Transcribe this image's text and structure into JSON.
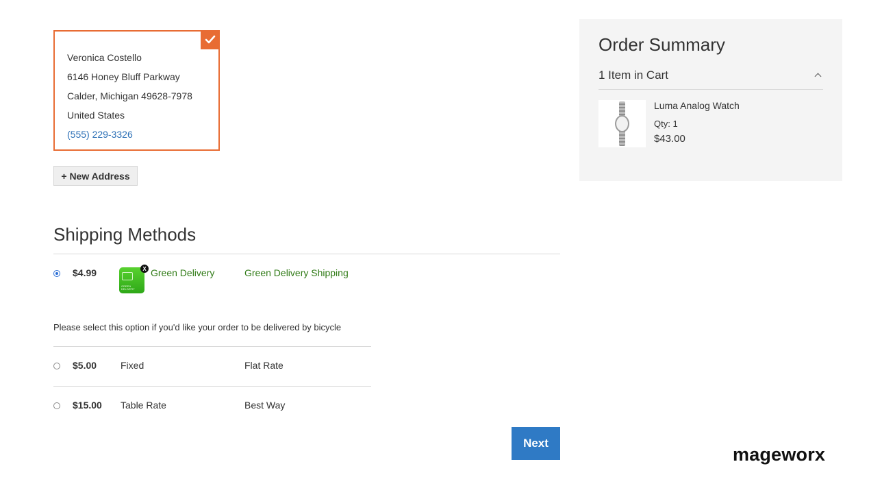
{
  "address": {
    "name": "Veronica Costello",
    "street": "6146 Honey Bluff Parkway",
    "city_line": "Calder, Michigan 49628-7978",
    "country": "United States",
    "phone": "(555) 229-3326",
    "selected_icon": "checkmark-icon"
  },
  "new_address_label": "+ New Address",
  "shipping": {
    "title": "Shipping Methods",
    "methods": [
      {
        "price": "$4.99",
        "method": "Green Delivery",
        "carrier": "Green Delivery Shipping",
        "selected": true,
        "icon": "green-delivery-icon",
        "icon_badge": "X",
        "icon_text": "GREEN DELIVERY",
        "note": "Please select this option if you'd like your order to be delivered by bicycle"
      },
      {
        "price": "$5.00",
        "method": "Fixed",
        "carrier": "Flat Rate",
        "selected": false
      },
      {
        "price": "$15.00",
        "method": "Table Rate",
        "carrier": "Best Way",
        "selected": false
      }
    ],
    "next_label": "Next"
  },
  "summary": {
    "title": "Order Summary",
    "items_count": "1 Item in Cart",
    "item": {
      "name": "Luma Analog Watch",
      "qty": "Qty: 1",
      "price": "$43.00",
      "image": "watch-image"
    }
  },
  "brand": "mageworx",
  "colors": {
    "accent": "#e86c33",
    "link": "#2a6eb5",
    "green": "#2f7a15",
    "primary_button": "#2f7ac5"
  }
}
